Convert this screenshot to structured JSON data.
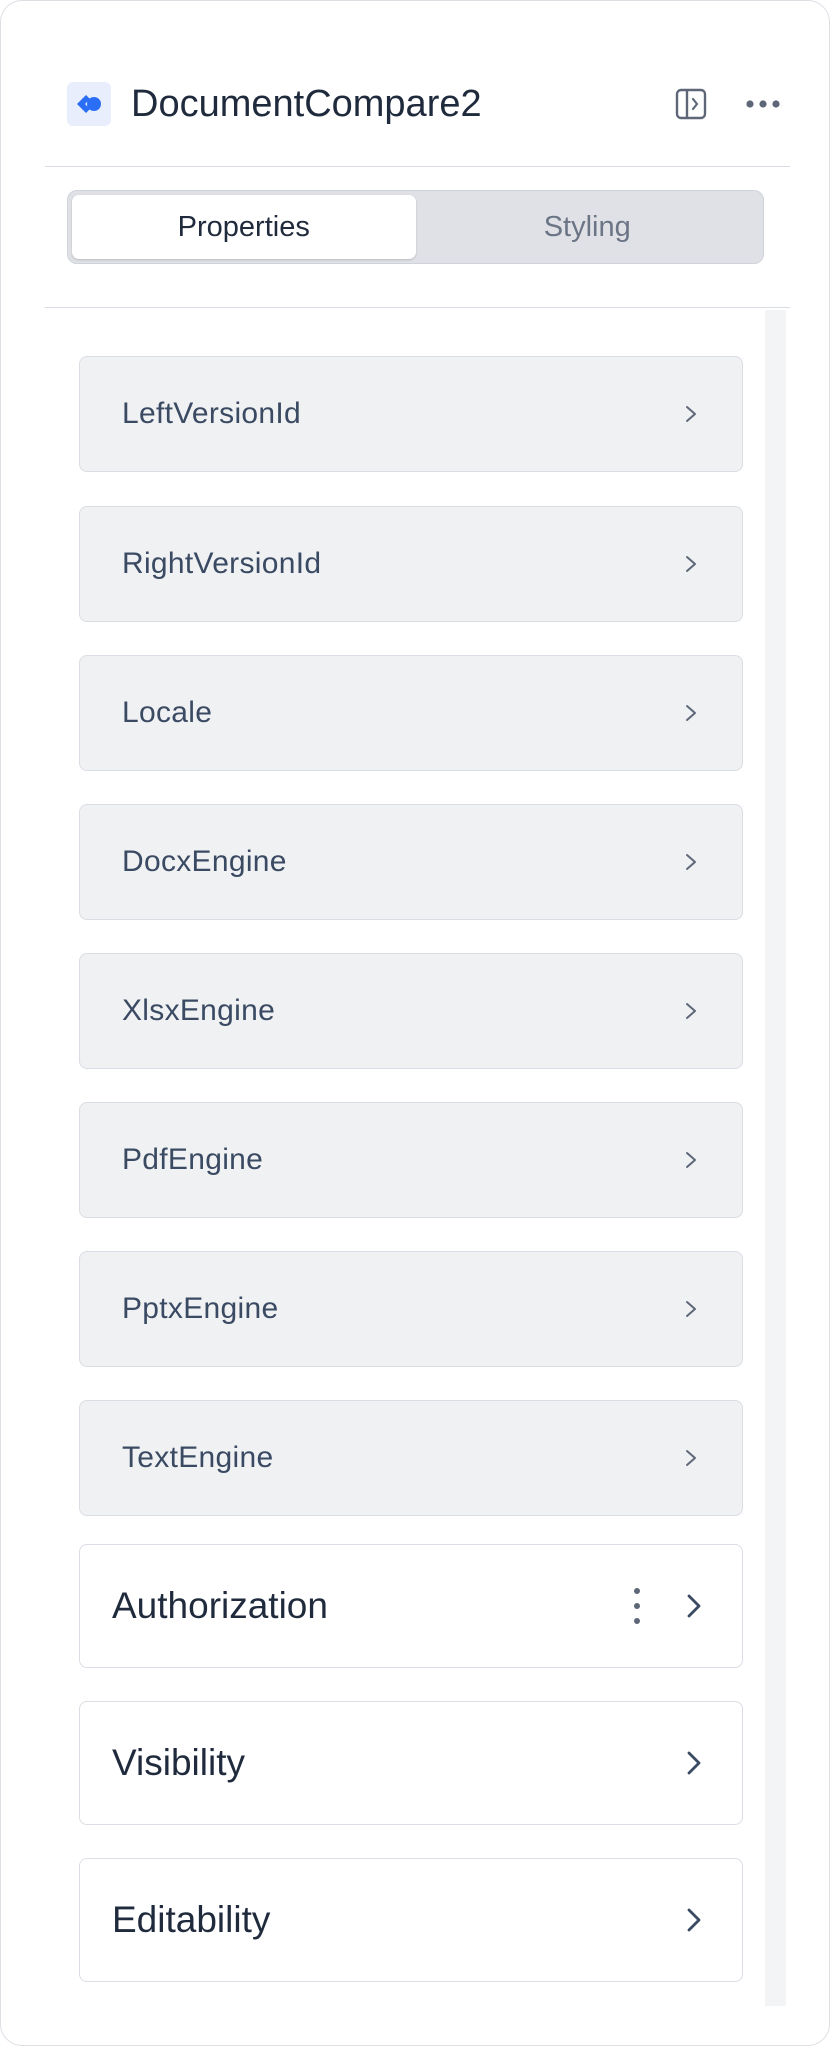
{
  "header": {
    "title": "DocumentCompare2",
    "logo_icon": "component-logo-icon",
    "panel_toggle_icon": "sidebar-toggle-icon",
    "more_icon": "more-horizontal-icon"
  },
  "tabs": [
    {
      "label": "Properties",
      "active": true
    },
    {
      "label": "Styling",
      "active": false
    }
  ],
  "properties": [
    {
      "label": "LeftVersionId"
    },
    {
      "label": "RightVersionId"
    },
    {
      "label": "Locale"
    },
    {
      "label": "DocxEngine"
    },
    {
      "label": "XlsxEngine"
    },
    {
      "label": "PdfEngine"
    },
    {
      "label": "PptxEngine"
    },
    {
      "label": "TextEngine"
    }
  ],
  "sections": [
    {
      "label": "Authorization",
      "has_menu": true
    },
    {
      "label": "Visibility",
      "has_menu": false
    },
    {
      "label": "Editability",
      "has_menu": false
    }
  ],
  "colors": {
    "accent": "#2b6ef6",
    "text": "#1f2a3c",
    "property_bg": "#f0f1f3",
    "border": "#dadde3"
  }
}
